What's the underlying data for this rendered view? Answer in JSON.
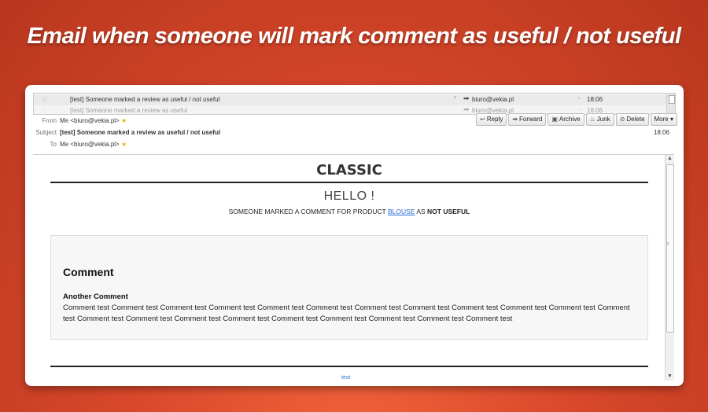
{
  "headline": "Email when someone will mark comment as useful  / not useful",
  "message_list": {
    "rows": [
      {
        "subject": "[test] Someone marked a review as useful / not useful",
        "sender": "biuro@vekia.pl",
        "time": "18:06"
      },
      {
        "subject": "[test] Someone marked a review as useful",
        "sender": "biuro@vekia.pl",
        "time": "18:06"
      }
    ]
  },
  "header": {
    "from_label": "From",
    "from_value": "Me <biuro@vekia.pl>",
    "subject_label": "Subject",
    "subject_value": "[test] Someone marked a review as useful / not useful",
    "to_label": "To",
    "to_value": "Me <biuro@vekia.pl>",
    "time": "18:06",
    "toolbar": {
      "reply": "Reply",
      "forward": "Forward",
      "archive": "Archive",
      "junk": "Junk",
      "delete": "Delete",
      "more": "More"
    }
  },
  "email": {
    "brand": "CLASSIC",
    "hello": "HELLO !",
    "notice_prefix": "SOMEONE MARKED A COMMENT FOR PRODUCT ",
    "product": "BLOUSE",
    "notice_mid": " AS ",
    "status": "NOT USEFUL",
    "comment_heading": "Comment",
    "comment_title": "Another Comment",
    "comment_text": "Comment test Comment test Comment test Comment test Comment test Comment test Comment test Comment test Comment test Comment test Comment test Comment test Comment test Comment test Comment test Comment test Comment test Comment test Comment test Comment test Comment test",
    "footer_link": "test"
  }
}
